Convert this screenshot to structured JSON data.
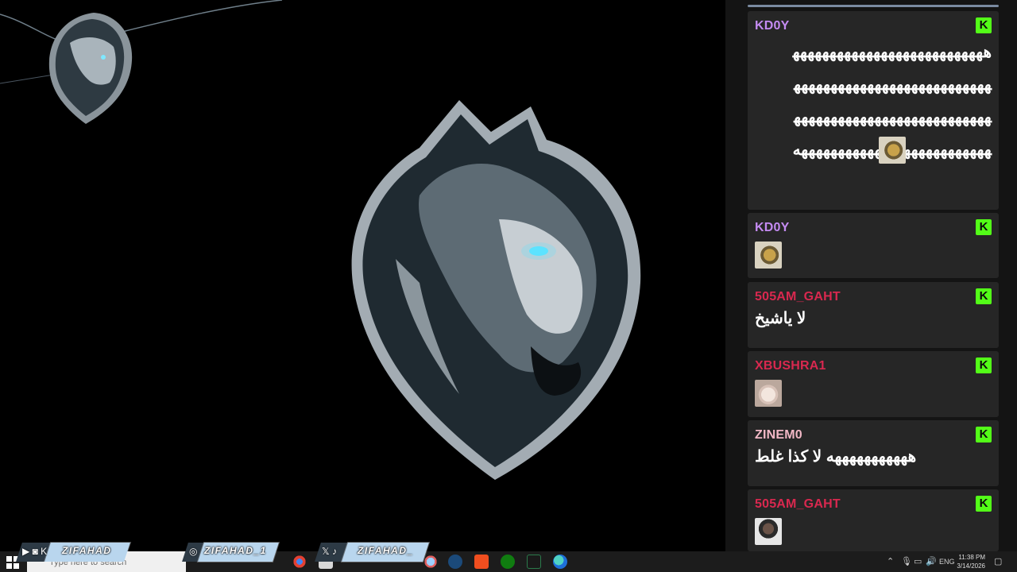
{
  "chat": {
    "messages": [
      {
        "user": "KD0Y",
        "user_color": "#c48bf2",
        "text": "هههههههههههههههههههههههههههههههههههههههههههههههههههههههههههههههههههههههههههههههههههههههههههههههههههههههههههه",
        "emote": "wasp-emote"
      },
      {
        "user": "KD0Y",
        "user_color": "#c48bf2",
        "text": "",
        "emote": "wasp-emote"
      },
      {
        "user": "505AM_GAHT",
        "user_color": "#d9284f",
        "text": "لا ياشيخ",
        "emote": ""
      },
      {
        "user": "XBUSHRA1",
        "user_color": "#d9284f",
        "text": "",
        "emote": "cat-emote"
      },
      {
        "user": "ZINEM0",
        "user_color": "#f2b8c6",
        "text": "هههههههههههه لا كذا غلط",
        "emote": ""
      },
      {
        "user": "505AM_GAHT",
        "user_color": "#d9284f",
        "text": "",
        "emote": "face-emote"
      }
    ],
    "platform_badge": "K",
    "badge_color": "#53fc18"
  },
  "socials": {
    "kick": {
      "label": "ZIFAHAD",
      "icons": "▶ ◙ K"
    },
    "instagram": {
      "label": "ZIFAHAD_1",
      "icon": "◎"
    },
    "x_tiktok": {
      "label": "ZIFAHAD_",
      "icons": "𝕏 ♪"
    }
  },
  "taskbar": {
    "search_placeholder": "Type here to search",
    "language": "ENG",
    "time": "11:38 PM",
    "date": "3/14/2026"
  }
}
